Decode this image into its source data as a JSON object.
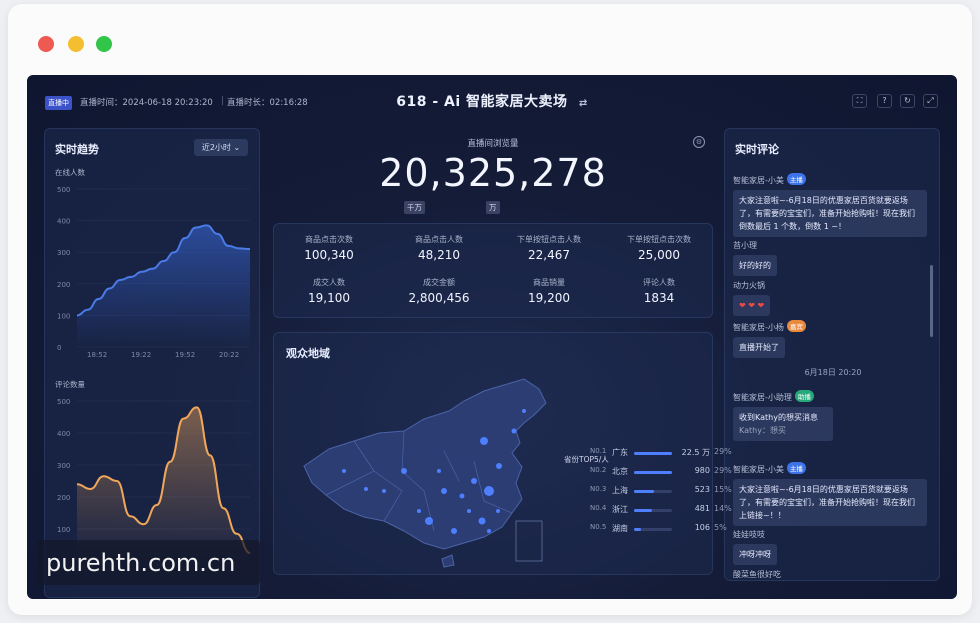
{
  "header": {
    "live_badge": "直播中",
    "start_time": "直播时间：2024-06-18 20:23:20",
    "duration": "直播时长：02:16:28",
    "title": "618 - Ai 智能家居大卖场",
    "swap_icon": "⇄"
  },
  "trend": {
    "title": "实时趋势",
    "range": "近2小时 ⌄",
    "online": {
      "label": "在线人数",
      "yticks": [
        "500",
        "400",
        "300",
        "200",
        "100",
        "0"
      ],
      "xticks": [
        "18:52",
        "19:22",
        "19:52",
        "20:22"
      ],
      "values": [
        100,
        118,
        152,
        185,
        212,
        222,
        238,
        248,
        272,
        300,
        345,
        378,
        385,
        358,
        320,
        312,
        310
      ]
    },
    "comments": {
      "label": "评论数量",
      "yticks": [
        "500",
        "400",
        "300",
        "200",
        "100"
      ],
      "values": [
        240,
        225,
        265,
        250,
        140,
        115,
        175,
        310,
        445,
        480,
        330,
        165,
        85,
        25
      ]
    }
  },
  "views": {
    "label": "直播间浏览量",
    "value": "20,325,278",
    "unit1": "千万",
    "unit2": "万"
  },
  "kpis": [
    {
      "label": "商品点击次数",
      "value": "100,340"
    },
    {
      "label": "商品点击人数",
      "value": "48,210"
    },
    {
      "label": "下单按钮点击人数",
      "value": "22,467"
    },
    {
      "label": "下单按钮点击次数",
      "value": "25,000"
    },
    {
      "label": "成交人数",
      "value": "19,100"
    },
    {
      "label": "成交金额",
      "value": "2,800,456"
    },
    {
      "label": "商品销量",
      "value": "19,200"
    },
    {
      "label": "评论人数",
      "value": "1834"
    }
  ],
  "map": {
    "title": "观众地域",
    "top_title": "省份TOP5/人",
    "ranks": [
      {
        "no": "N0.1",
        "name": "广东",
        "value": "22.5 万",
        "pct": "29%",
        "share": 0.29
      },
      {
        "no": "N0.2",
        "name": "北京",
        "value": "980",
        "pct": "29%",
        "share": 0.29
      },
      {
        "no": "N0.3",
        "name": "上海",
        "value": "523",
        "pct": "15%",
        "share": 0.15
      },
      {
        "no": "N0.4",
        "name": "浙江",
        "value": "481",
        "pct": "14%",
        "share": 0.14
      },
      {
        "no": "N0.5",
        "name": "湖南",
        "value": "106",
        "pct": "5%",
        "share": 0.05
      }
    ]
  },
  "comments": {
    "title": "实时评论",
    "c1": {
      "name": "智能家居-小美",
      "tag": "主播",
      "text": "大家注意啦~-6月18日的优惠家居百货就要返场了，有需要的宝宝们，准备开始抢购啦！现在我们倒数最后 1 个数，倒数 1 ~！"
    },
    "c2": {
      "name": "苔小理",
      "text": "好的好的"
    },
    "c3": {
      "name": "动力火锅",
      "text": "❤ ❤ ❤"
    },
    "c4": {
      "name": "智能家居-小杨",
      "tag": "嘉宾",
      "text": "直播开始了"
    },
    "time": "6月18日 20:20",
    "c5": {
      "name": "智能家居-小助理",
      "tag": "助播",
      "text": "收到Kathy的想买消息",
      "sub": "Kathy：想买"
    },
    "c6": {
      "name": "智能家居-小美",
      "tag": "主播",
      "text": "大家注意啦~-6月18日的优惠家居百货就要返场了，有需要的宝宝们，准备开始抢购啦！现在我们上链接~！！"
    },
    "c7": {
      "name": "娃娃吱吱",
      "text": "冲呀冲呀"
    },
    "c8": {
      "name": "酸菜鱼很好吃"
    }
  },
  "watermark": "purehth.com.cn",
  "colors": {
    "online_line": "#4a7be8",
    "comment_line": "#f0a75a",
    "accent": "#3b52c9"
  }
}
